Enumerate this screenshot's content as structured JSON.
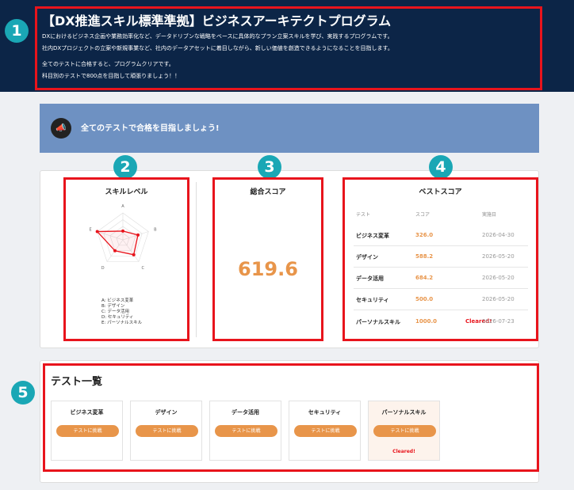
{
  "header": {
    "title": "【DX推進スキル標準準拠】ビジネスアーキテクトプログラム",
    "desc_line1": "DXにおけるビジネス企画や業務効率化など、データドリブンな戦略をベースに具体的なプラン立案スキルを学び、実践するプログラムです。",
    "desc_line2": "社内DXプロジェクトの立案や新規事業など、社内のデータアセットに着目しながら、新しい価値を創造できるようになることを目指します。",
    "desc_line3": "全てのテストに合格すると、プログラムクリアです。",
    "desc_line4": "科目別のテストで800点を目指して頑張りましょう！！"
  },
  "badges": [
    "1",
    "2",
    "3",
    "4",
    "5"
  ],
  "banner": {
    "icon": "megaphone-icon",
    "text": "全てのテストで合格を目指しましょう!"
  },
  "skill_level": {
    "title": "スキルレベル",
    "axes": [
      "A",
      "B",
      "C",
      "D",
      "E"
    ],
    "values": [
      326.0,
      588.2,
      684.2,
      500.0,
      1000.0
    ],
    "max": 1000,
    "legend": [
      "A: ビジネス変革",
      "B: デザイン",
      "C: データ活用",
      "D: セキュリティ",
      "E: パーソナルスキル"
    ]
  },
  "total_score": {
    "title": "総合スコア",
    "value": "619.6"
  },
  "best_score": {
    "title": "ベストスコア",
    "headers": [
      "テスト",
      "スコア",
      "実施日"
    ],
    "rows": [
      {
        "name": "ビジネス変革",
        "score": "326.0",
        "cleared": "",
        "date": "2026-04-30"
      },
      {
        "name": "デザイン",
        "score": "588.2",
        "cleared": "",
        "date": "2026-05-20"
      },
      {
        "name": "データ活用",
        "score": "684.2",
        "cleared": "",
        "date": "2026-05-20"
      },
      {
        "name": "セキュリティ",
        "score": "500.0",
        "cleared": "",
        "date": "2026-05-20"
      },
      {
        "name": "パーソナルスキル",
        "score": "1000.0",
        "cleared": "Cleared!",
        "date": "2026-07-23"
      }
    ]
  },
  "test_list": {
    "title": "テスト一覧",
    "button_label": "テストに挑戦",
    "items": [
      {
        "name": "ビジネス変革",
        "cleared": ""
      },
      {
        "name": "デザイン",
        "cleared": ""
      },
      {
        "name": "データ活用",
        "cleared": ""
      },
      {
        "name": "セキュリティ",
        "cleared": ""
      },
      {
        "name": "パーソナルスキル",
        "cleared": "Cleared!"
      }
    ]
  },
  "colors": {
    "accent": "#e8954a",
    "annotation": "#e8141c",
    "badge": "#1aa7b5",
    "header_bg": "#0c2547",
    "banner_bg": "#6e91c2"
  }
}
